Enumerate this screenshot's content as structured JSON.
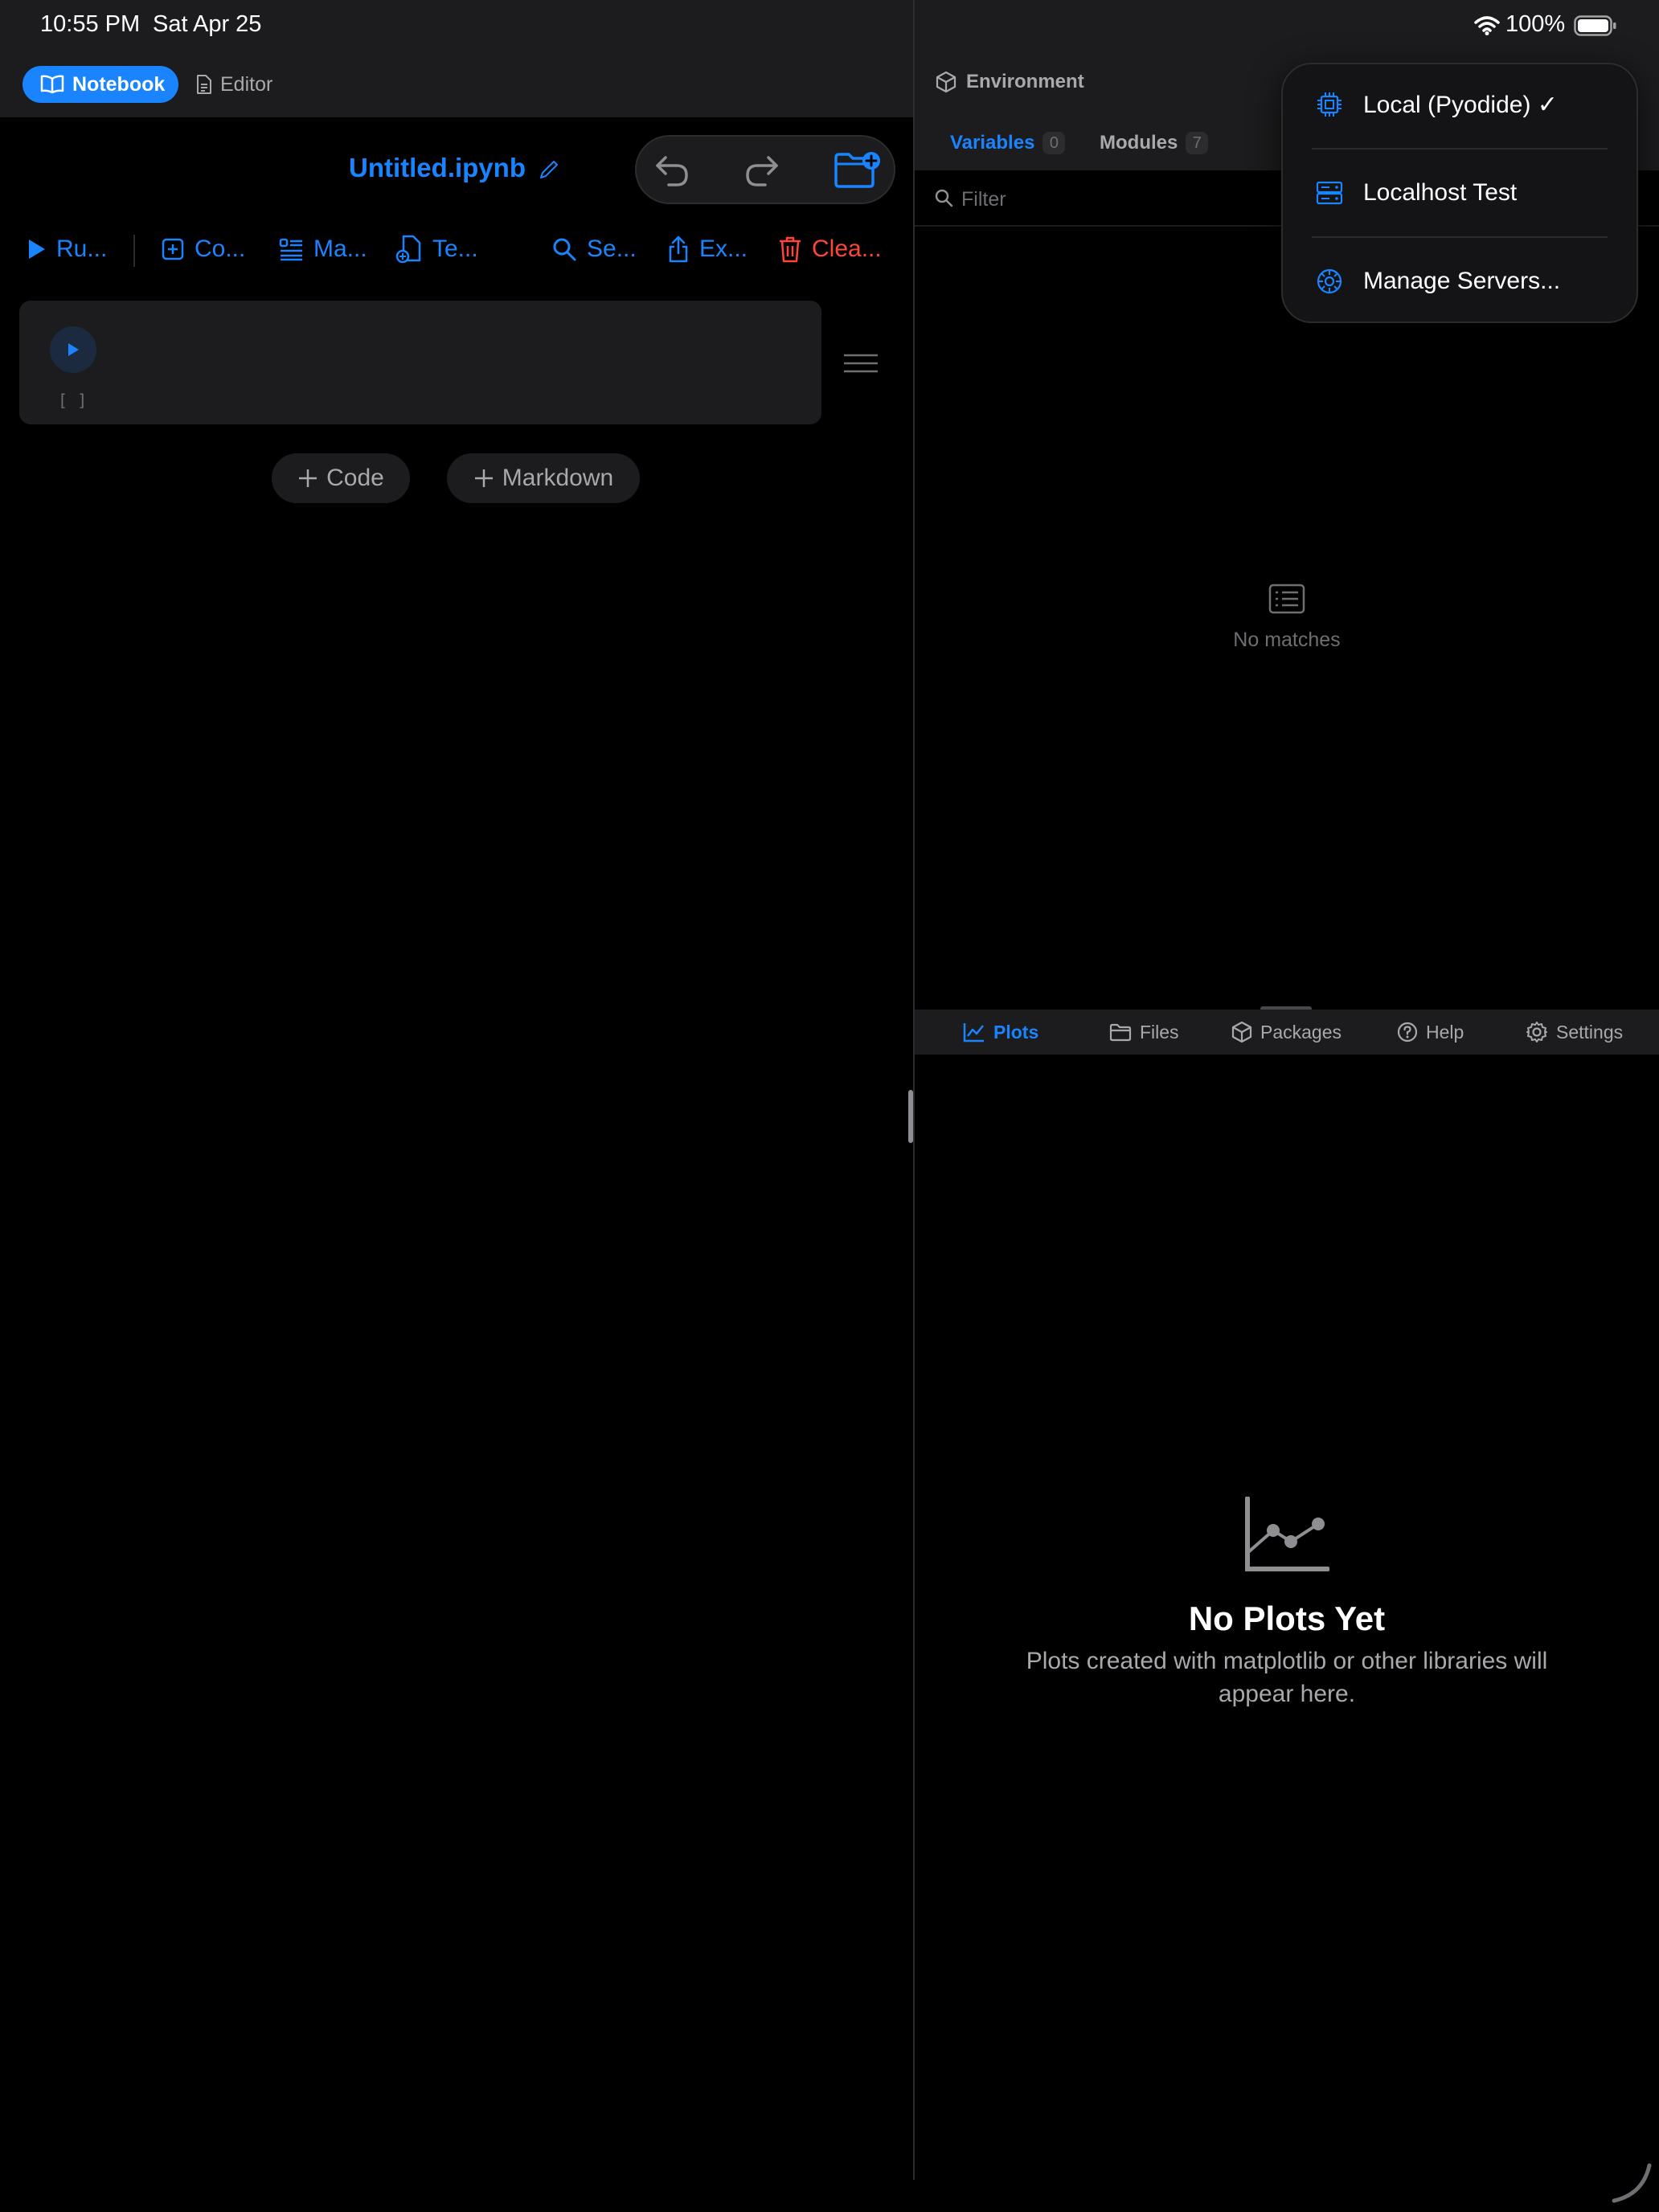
{
  "status_bar": {
    "time": "10:55 PM",
    "date": "Sat Apr 25",
    "battery": "100%"
  },
  "mode_switch": {
    "notebook": "Notebook",
    "editor": "Editor"
  },
  "notebook": {
    "title": "Untitled.ipynb"
  },
  "toolbar": {
    "run": "Ru...",
    "code": "Co...",
    "markdown": "Ma...",
    "template": "Te...",
    "search": "Se...",
    "export": "Ex...",
    "clear": "Clea..."
  },
  "cell": {
    "execution_count": "[ ]"
  },
  "add_buttons": {
    "code": "Code",
    "markdown": "Markdown"
  },
  "environment": {
    "title": "Environment",
    "tabs": [
      {
        "label": "Variables",
        "count": "0"
      },
      {
        "label": "Modules",
        "count": "7"
      }
    ],
    "filter_placeholder": "Filter",
    "empty_text": "No matches"
  },
  "bottom_tabs": [
    "Plots",
    "Files",
    "Packages",
    "Help",
    "Settings"
  ],
  "plots": {
    "heading": "No Plots Yet",
    "subtitle": "Plots created with matplotlib or other libraries will appear here."
  },
  "server_menu": {
    "items": [
      {
        "label": "Local (Pyodide) ✓",
        "icon": "cpu-icon",
        "selected": true
      },
      {
        "label": "Localhost Test",
        "icon": "server-icon",
        "selected": false
      },
      {
        "label": "Manage Servers...",
        "icon": "gear-icon",
        "selected": false
      }
    ]
  },
  "colors": {
    "accent": "#1a84ff",
    "danger": "#ff453a",
    "panel": "#1c1c1e",
    "background": "#000000"
  }
}
